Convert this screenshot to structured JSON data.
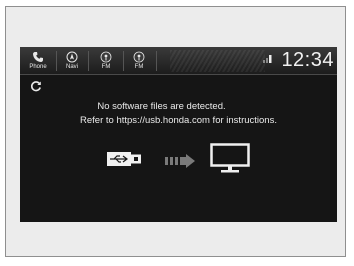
{
  "statusbar": {
    "tabs": [
      {
        "label": "Phone"
      },
      {
        "label": "Navi"
      },
      {
        "label": "FM"
      },
      {
        "label": "FM"
      }
    ],
    "clock": "12:34"
  },
  "message": {
    "line1": "No software files are detected.",
    "line2": "Refer to https://usb.honda.com for instructions."
  },
  "colors": {
    "screen_bg": "#151515",
    "frame_bg": "#ececec",
    "text": "#eaeaea"
  },
  "icons": [
    "phone-icon",
    "navi-icon",
    "fm-radio-icon",
    "fm-icon",
    "refresh-icon",
    "usb-drive-icon",
    "transfer-arrow-icon",
    "monitor-icon",
    "signal-icon"
  ]
}
